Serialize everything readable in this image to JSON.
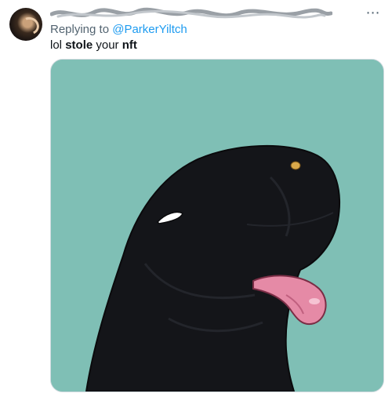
{
  "tweet": {
    "replying_prefix": "Replying to",
    "replying_handle": "@ParkerYiltch",
    "text_parts": [
      "lol ",
      "stole",
      " your ",
      "nft"
    ],
    "more_icon": "⋯"
  },
  "media": {
    "background_color": "#7fbfb5",
    "body_color": "#141519",
    "tongue_color": "#e58aa6",
    "eye_color": "#d9a84a"
  },
  "icons": {
    "avatar": "avatar",
    "more": "more-options-icon"
  }
}
